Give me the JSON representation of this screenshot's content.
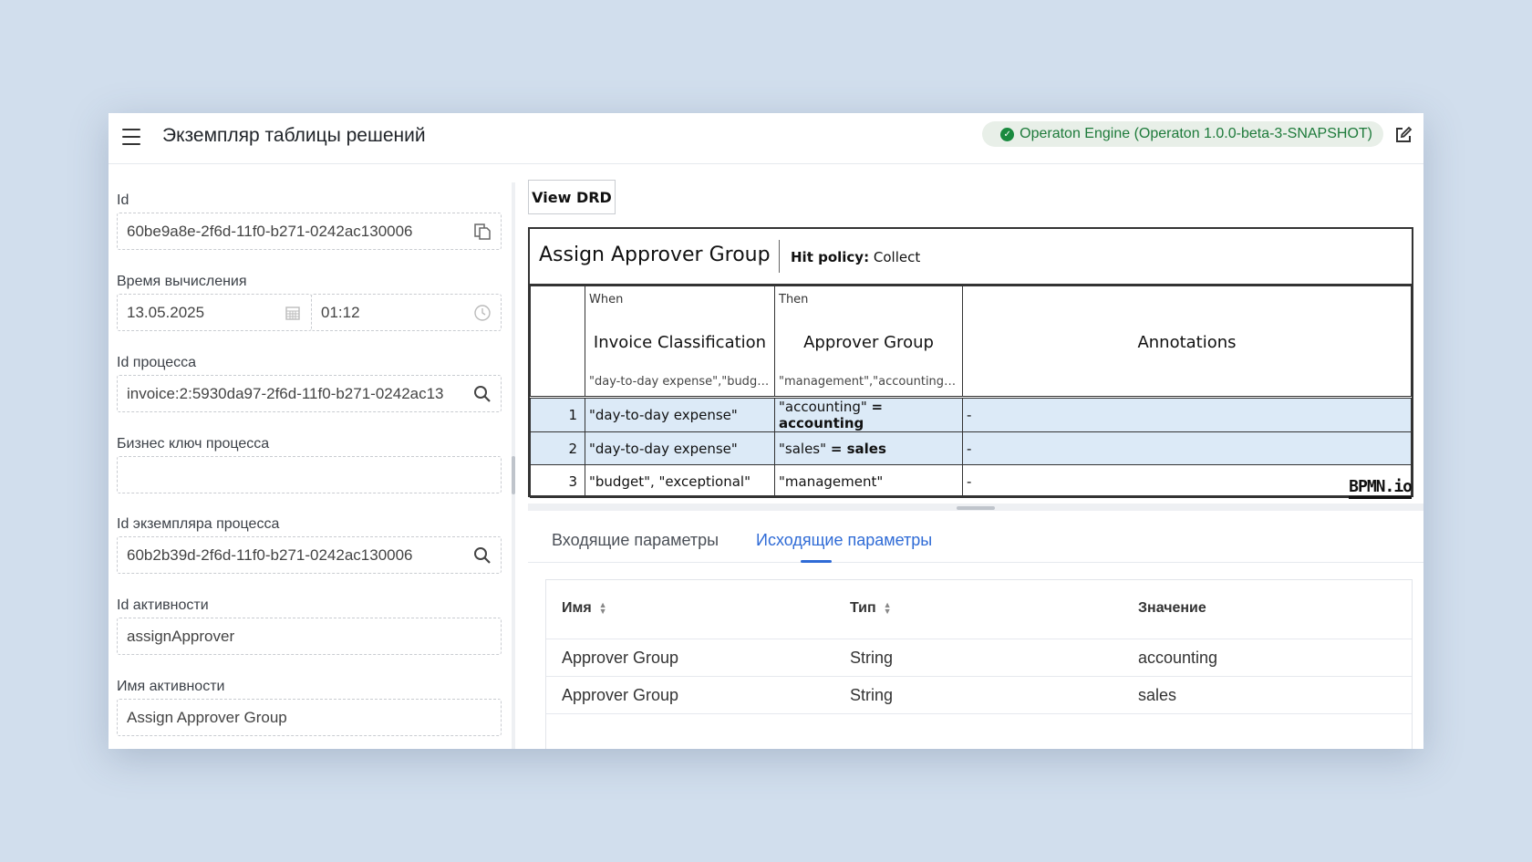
{
  "header": {
    "title": "Экземпляр таблицы решений",
    "engine_label": "Operaton Engine (Operaton 1.0.0-beta-3-SNAPSHOT)",
    "accent_color": "#1a8a3f"
  },
  "left": {
    "id_label": "Id",
    "id_value": "60be9a8e-2f6d-11f0-b271-0242ac130006",
    "eval_time_label": "Время вычисления",
    "eval_date": "13.05.2025",
    "eval_time": "01:12",
    "process_id_label": "Id процесса",
    "process_id_value": "invoice:2:5930da97-2f6d-11f0-b271-0242ac13",
    "business_key_label": "Бизнес ключ процесса",
    "business_key_value": "",
    "process_instance_label": "Id экземпляра процесса",
    "process_instance_value": "60b2b39d-2f6d-11f0-b271-0242ac130006",
    "activity_id_label": "Id активности",
    "activity_id_value": "assignApprover",
    "activity_name_label": "Имя активности",
    "activity_name_value": "Assign Approver Group"
  },
  "right": {
    "view_drd_label": "View DRD",
    "dmn": {
      "name": "Assign Approver Group",
      "hit_policy_label": "Hit policy:",
      "hit_policy_value": "Collect",
      "when_label": "When",
      "then_label": "Then",
      "input_col": "Invoice Classification",
      "input_values": "\"day-to-day expense\",\"budget\",\"...",
      "output_col": "Approver Group",
      "output_values": "\"management\",\"accounting\",\"sa...",
      "annotations_col": "Annotations",
      "rows": [
        {
          "num": "1",
          "input": "\"day-to-day expense\"",
          "output_text": "\"accounting\"",
          "output_result": "= accounting",
          "annotation": "-"
        },
        {
          "num": "2",
          "input": "\"day-to-day expense\"",
          "output_text": "\"sales\"",
          "output_result": "= sales",
          "annotation": "-"
        },
        {
          "num": "3",
          "input": "\"budget\", \"exceptional\"",
          "output_text": "\"management\"",
          "output_result": "",
          "annotation": "-"
        }
      ],
      "brand": "BPMN.io",
      "highlight_color": "#dceaf7"
    },
    "tabs": {
      "incoming": "Входящие параметры",
      "outgoing": "Исходящие параметры"
    },
    "vars_table": {
      "headers": {
        "name": "Имя",
        "type": "Тип",
        "value": "Значение"
      },
      "rows": [
        {
          "name": "Approver Group",
          "type": "String",
          "value": "accounting"
        },
        {
          "name": "Approver Group",
          "type": "String",
          "value": "sales"
        }
      ]
    }
  }
}
